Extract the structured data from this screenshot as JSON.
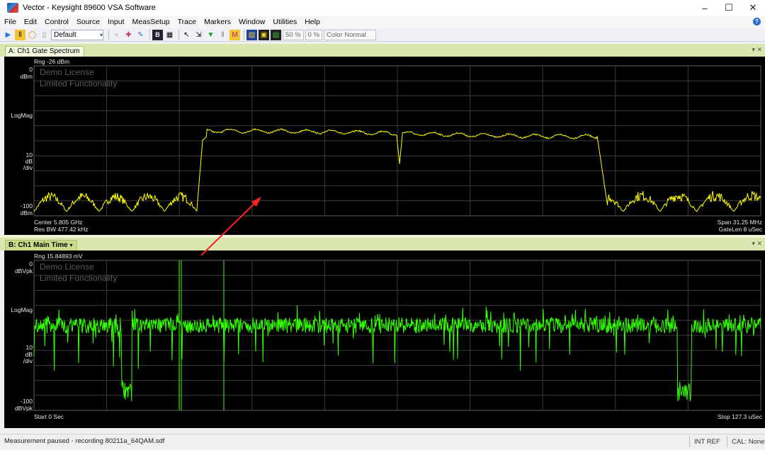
{
  "window": {
    "title": "Vector - Keysight 89600 VSA Software",
    "controls": [
      "–",
      "☐",
      "✕"
    ]
  },
  "menu": [
    "File",
    "Edit",
    "Control",
    "Source",
    "Input",
    "MeasSetup",
    "Trace",
    "Markers",
    "Window",
    "Utilities",
    "Help"
  ],
  "toolbar": {
    "preset": "Default",
    "zoom_a": "50 %",
    "zoom_b": "0 %",
    "color_scheme": "Color Normal"
  },
  "traceA": {
    "tab": "A: Ch1 Gate Spectrum",
    "range": "Rng -26 dBm",
    "top_value": "0",
    "top_unit": "dBm",
    "format": "LogMag",
    "scale_value": "10",
    "scale_unit1": "dB",
    "scale_unit2": "/div",
    "bottom_value": "-100",
    "bottom_unit": "dBm",
    "center": "Center 5.805 GHz",
    "res_bw": "Res BW 477.42 kHz",
    "span": "Span 31.25 MHz",
    "gate_len": "GateLen 8 uSec",
    "watermark1": "Demo License",
    "watermark2": "Limited Functionality",
    "trace_color": "#ffff00"
  },
  "traceB": {
    "tab": "B: Ch1 Main Time",
    "tab_arrow": "▾",
    "range": "Rng 15.84893 mV",
    "top_value": "0",
    "top_unit": "dBVpk",
    "format": "LogMag",
    "scale_value": "10",
    "scale_unit1": "dB",
    "scale_unit2": "/div",
    "bottom_value": "-100",
    "bottom_unit": "dBVpk",
    "start": "Start 0  Sec",
    "stop": "Stop 127.3 uSec",
    "watermark1": "Demo License",
    "watermark2": "Limited Functionality",
    "trace_color": "#33ff00"
  },
  "status": {
    "message": "Measurement paused - recording 80211a_64QAM.sdf",
    "ref": "INT REF",
    "cal": "CAL: None"
  },
  "annotation_color": "#ff2020"
}
